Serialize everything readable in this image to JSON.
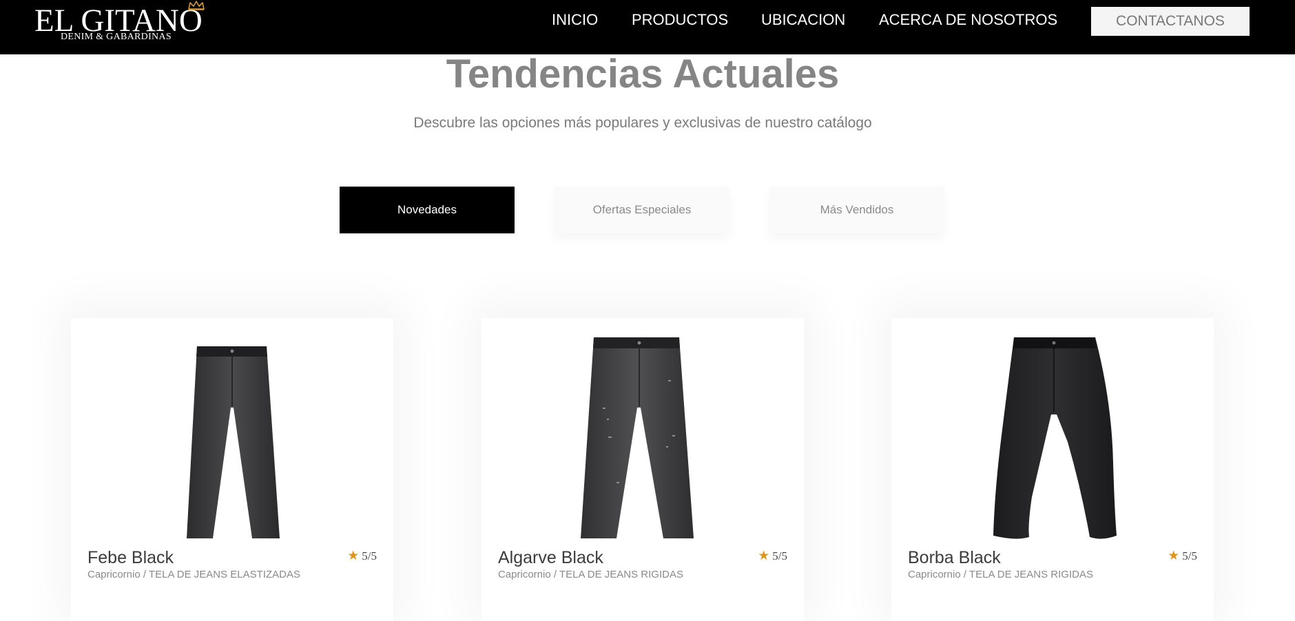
{
  "header": {
    "logo_title": "EL GITANO",
    "logo_subtitle": "DENIM & GABARDINAS",
    "nav": {
      "inicio": "INICIO",
      "productos": "PRODUCTOS",
      "ubicacion": "UBICACION",
      "acerca": "ACERCA DE NOSOTROS"
    },
    "contact_label": "CONTACTANOS"
  },
  "hero": {
    "title": "Tendencias Actuales",
    "subtitle": "Descubre las opciones más populares y exclusivas de nuestro catálogo"
  },
  "tabs": [
    {
      "label": "Novedades",
      "active": true
    },
    {
      "label": "Ofertas Especiales",
      "active": false
    },
    {
      "label": "Más Vendidos",
      "active": false
    }
  ],
  "products": [
    {
      "name": "Febe Black",
      "meta": "Capricornio / TELA DE JEANS ELASTIZADAS",
      "rating": "5/5",
      "image": "skinny-black-jeans"
    },
    {
      "name": "Algarve Black",
      "meta": "Capricornio / TELA DE JEANS RIGIDAS",
      "rating": "5/5",
      "image": "distressed-black-jeans"
    },
    {
      "name": "Borba Black",
      "meta": "Capricornio / TELA DE JEANS RIGIDAS",
      "rating": "5/5",
      "image": "baggy-black-jeans"
    }
  ],
  "colors": {
    "header_bg": "#000000",
    "accent_star": "#e0951f",
    "active_tab_bg": "#000000"
  }
}
